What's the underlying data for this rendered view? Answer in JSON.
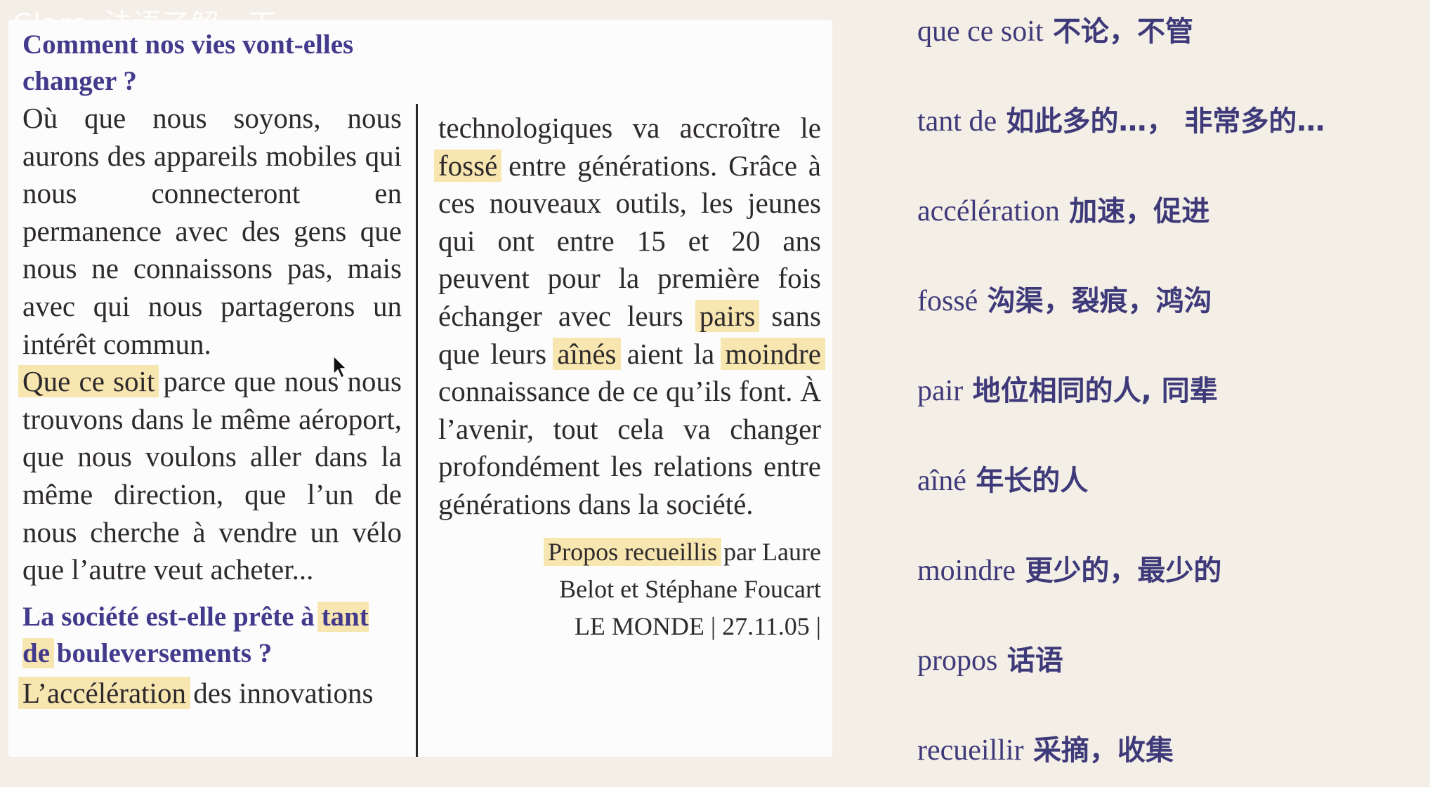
{
  "watermark": "Clara_法语了解一下",
  "article": {
    "heading1": "Comment nos vies vont-elles changer ?",
    "left_text_1": "Où que nous soyons, nous aurons des appareils mobiles qui nous connecteront en permanence avec des gens que nous ne connaissons pas, mais avec qui nous partagerons un intérêt commun.",
    "hl_que_ce_soit": "Que ce soit",
    "left_text_2": " parce que nous nous trouvons dans le même aéroport, que nous voulons aller dans la même direction, que l’un de nous cherche à vendre un vélo que l’autre veut acheter...",
    "heading2_start": "La société est-elle prête à ",
    "hl_tant_de": "tant de",
    "heading2_end": " bouleversements ?",
    "hl_acceleration": "L’accélération",
    "left_text_3": " des innovations",
    "right_text_1": "technologiques va accroître le ",
    "hl_fosse": "fossé",
    "right_text_2": " entre générations. Grâce à ces nouveaux outils, les jeunes qui ont entre 15 et 20 ans peuvent pour la première fois échanger avec leurs ",
    "hl_pairs": "pairs",
    "right_text_3": " sans que leurs ",
    "hl_aines": "aînés",
    "right_text_4": " aient la ",
    "hl_moindre": "moindre",
    "right_text_5": " connaissance de ce qu’ils font. À l’avenir, tout cela va changer profondément les relations entre générations dans la société.",
    "credit_hl_propos": "Propos",
    "credit_hl_recueillis": "recueillis",
    "credit_text_1": " par Laure",
    "credit_text_2": "Belot et Stéphane Foucart",
    "credit_text_3": "LE MONDE | 27.11.05 |"
  },
  "glossary": [
    {
      "fr": "que ce soit",
      "zh": "不论，不管"
    },
    {
      "fr": "tant de",
      "zh": "如此多的…， 非常多的…"
    },
    {
      "fr": "accélération",
      "zh": "加速，促进"
    },
    {
      "fr": "fossé",
      "zh": "沟渠，裂痕，鸿沟"
    },
    {
      "fr": "pair",
      "zh": "地位相同的人, 同辈"
    },
    {
      "fr": "aîné",
      "zh": "年长的人"
    },
    {
      "fr": "moindre",
      "zh": "更少的，最少的"
    },
    {
      "fr": "propos",
      "zh": "话语"
    },
    {
      "fr": "recueillir",
      "zh": "采摘，收集"
    }
  ],
  "colors": {
    "page_bg": "#f4efe6",
    "heading": "#433a8c",
    "highlight": "#f8e6b0",
    "gloss_text": "#3e3a7a"
  }
}
